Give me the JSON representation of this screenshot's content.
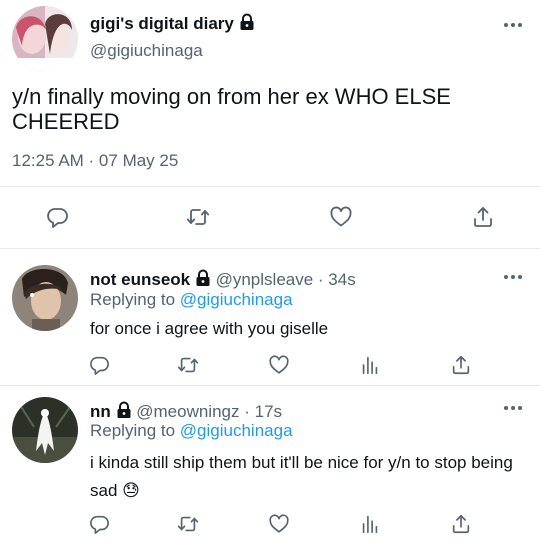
{
  "main_tweet": {
    "display_name": "gigi's digital diary",
    "handle": "@gigiuchinaga",
    "text": "y/n finally moving on from her ex WHO ELSE CHEERED",
    "timestamp": "12:25 AM · 07 May 25",
    "actions": [
      "reply-icon",
      "retweet-icon",
      "like-icon",
      "share-icon"
    ]
  },
  "replies": [
    {
      "display_name": "not eunseok",
      "handle": "@ynplsleave",
      "time": "· 34s",
      "replying_prefix": "Replying to",
      "replying_to": "@gigiuchinaga",
      "text": "for once i agree with you giselle",
      "actions": [
        "reply-icon",
        "retweet-icon",
        "like-icon",
        "analytics-icon",
        "share-icon"
      ]
    },
    {
      "display_name": "nn",
      "handle": "@meowningz",
      "time": "· 17s",
      "replying_prefix": "Replying to",
      "replying_to": "@gigiuchinaga",
      "text": "i kinda still ship them but it'll be nice for y/n to stop being sad",
      "emoji": "😓",
      "actions": [
        "reply-icon",
        "retweet-icon",
        "like-icon",
        "analytics-icon",
        "share-icon"
      ]
    }
  ],
  "colors": {
    "text": "#0f1419",
    "muted": "#536471",
    "link": "#1d9bf0",
    "divider": "#e6e9ec"
  }
}
